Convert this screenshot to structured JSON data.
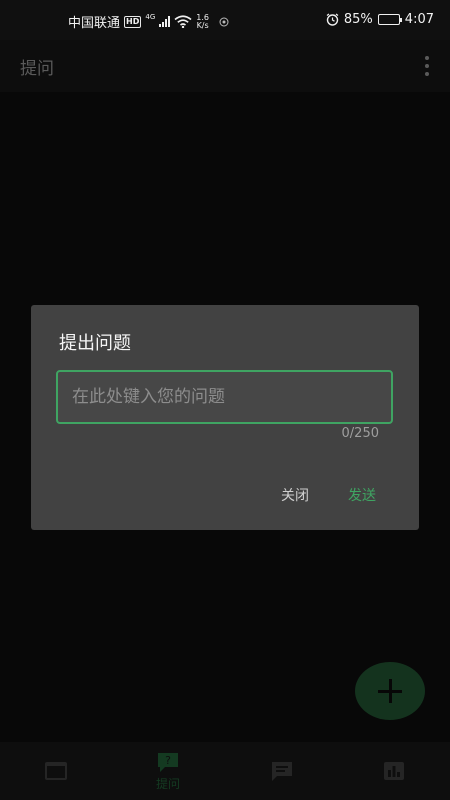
{
  "status_bar": {
    "carrier": "中国联通",
    "hd": "HD",
    "network": "4G",
    "speed_value": "1.6",
    "speed_unit": "K/s",
    "battery": "85%",
    "battery_level_pct": 85,
    "time": "4:07"
  },
  "app_bar": {
    "title": "提问"
  },
  "dialog": {
    "title": "提出问题",
    "input_placeholder": "在此处键入您的问题",
    "input_value": "",
    "counter": "0/250",
    "close_label": "关闭",
    "send_label": "发送"
  },
  "bottom_nav": {
    "items": [
      {
        "icon": "window-icon",
        "label": ""
      },
      {
        "icon": "question-bubble-icon",
        "label": "提问"
      },
      {
        "icon": "message-icon",
        "label": ""
      },
      {
        "icon": "bar-chart-icon",
        "label": ""
      }
    ]
  },
  "colors": {
    "accent": "#3fa462",
    "dialog_bg": "#424242",
    "page_bg": "#0d0d0d",
    "fab_bg": "#1f4f2e"
  }
}
